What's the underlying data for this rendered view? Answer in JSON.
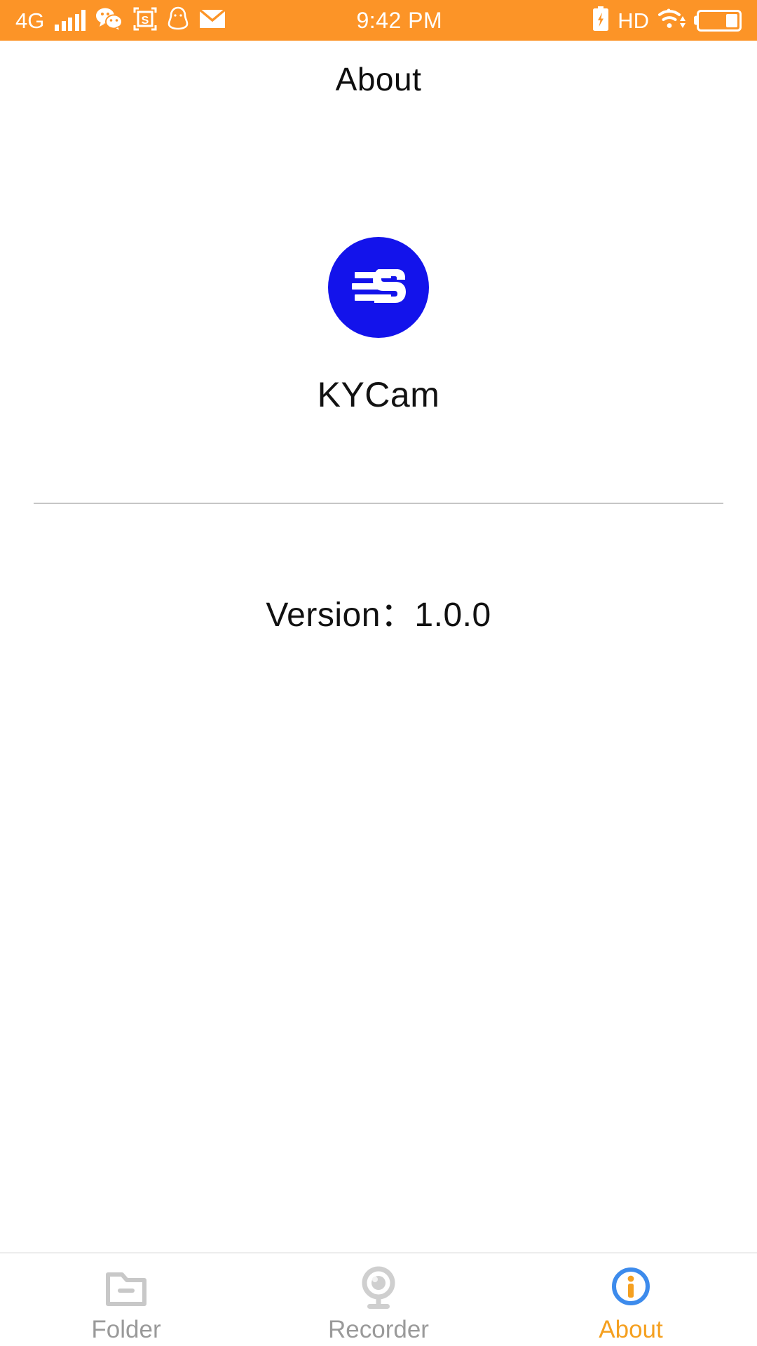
{
  "status_bar": {
    "background_color": "#FC9427",
    "network_label": "4G",
    "signal_bars": 5,
    "left_icons": [
      "wechat-icon",
      "screenshot-s-icon",
      "qq-penguin-icon",
      "mail-icon"
    ],
    "clock": "9:42 PM",
    "hd_label": "HD",
    "right_icons": [
      "battery-charging-icon",
      "wifi-icon",
      "battery-icon"
    ],
    "battery_level_percent": 30
  },
  "header": {
    "title": "About"
  },
  "app": {
    "logo_icon": "kycam-logo-icon",
    "logo_background_color": "#1313EB",
    "logo_mark_color": "#FFFFFF",
    "name": "KYCam"
  },
  "version": {
    "text": "Version：1.0.0",
    "label": "Version",
    "separator": "：",
    "value": "1.0.0"
  },
  "divider": {
    "color": "#c6c6c6"
  },
  "tab_bar": {
    "active_index": 2,
    "inactive_color": "#9a9a9a",
    "active_color": "#F5A020",
    "about_icon_ring_color": "#3D8BEC",
    "items": [
      {
        "label": "Folder",
        "icon": "folder-icon"
      },
      {
        "label": "Recorder",
        "icon": "webcam-icon"
      },
      {
        "label": "About",
        "icon": "info-circle-icon"
      }
    ]
  }
}
